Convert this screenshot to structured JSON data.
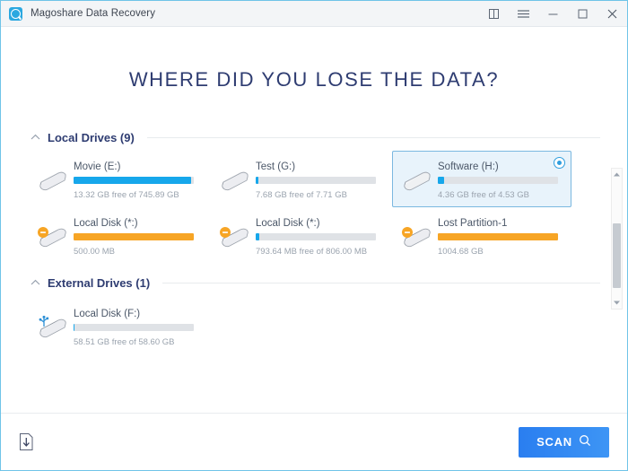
{
  "titlebar": {
    "app_name": "Magoshare Data Recovery",
    "logo_icon": "app-logo-icon",
    "controls": [
      {
        "name": "book-icon",
        "label": ""
      },
      {
        "name": "menu-icon",
        "label": ""
      },
      {
        "name": "minimize-icon",
        "label": ""
      },
      {
        "name": "maximize-icon",
        "label": ""
      },
      {
        "name": "close-icon",
        "label": ""
      }
    ]
  },
  "main": {
    "headline": "WHERE DID YOU LOSE THE DATA?"
  },
  "groups": [
    {
      "title": "Local Drives (9)",
      "collapsed": false,
      "drives": [
        {
          "label": "Movie (E:)",
          "sub": "13.32 GB free of 745.89 GB",
          "bar_percent": 98,
          "bar_color": "#17a7eb",
          "icon": "hard-drive-icon",
          "selected": false
        },
        {
          "label": "Test (G:)",
          "sub": "7.68 GB free of 7.71 GB",
          "bar_percent": 2,
          "bar_color": "#17a7eb",
          "icon": "hard-drive-icon",
          "selected": false
        },
        {
          "label": "Software (H:)",
          "sub": "4.36 GB free of 4.53 GB",
          "bar_percent": 5,
          "bar_color": "#17a7eb",
          "icon": "hard-drive-icon",
          "selected": true
        },
        {
          "label": "Local Disk (*:)",
          "sub": "500.00 MB",
          "bar_percent": 100,
          "bar_color": "#f7a525",
          "icon": "lost-partition-icon",
          "selected": false
        },
        {
          "label": "Local Disk (*:)",
          "sub": "793.64 MB free of 806.00 MB",
          "bar_percent": 3,
          "bar_color": "#17a7eb",
          "icon": "lost-partition-icon",
          "selected": false
        },
        {
          "label": "Lost Partition-1",
          "sub": "1004.68 GB",
          "bar_percent": 100,
          "bar_color": "#f7a525",
          "icon": "lost-partition-icon",
          "selected": false
        }
      ]
    },
    {
      "title": "External Drives (1)",
      "collapsed": false,
      "drives": [
        {
          "label": "Local Disk (F:)",
          "sub": "58.51 GB free of 58.60 GB",
          "bar_percent": 1,
          "bar_color": "#17a7eb",
          "icon": "usb-drive-icon",
          "selected": false
        }
      ]
    }
  ],
  "footer": {
    "import_icon": "import-session-icon",
    "scan_label": "SCAN",
    "scan_icon": "search-icon"
  },
  "colors": {
    "accent_blue": "#2a7ef0",
    "bar_blue": "#17a7eb",
    "bar_orange": "#f7a525",
    "heading_navy": "#2e3c71",
    "window_border": "#6fc4e8"
  }
}
